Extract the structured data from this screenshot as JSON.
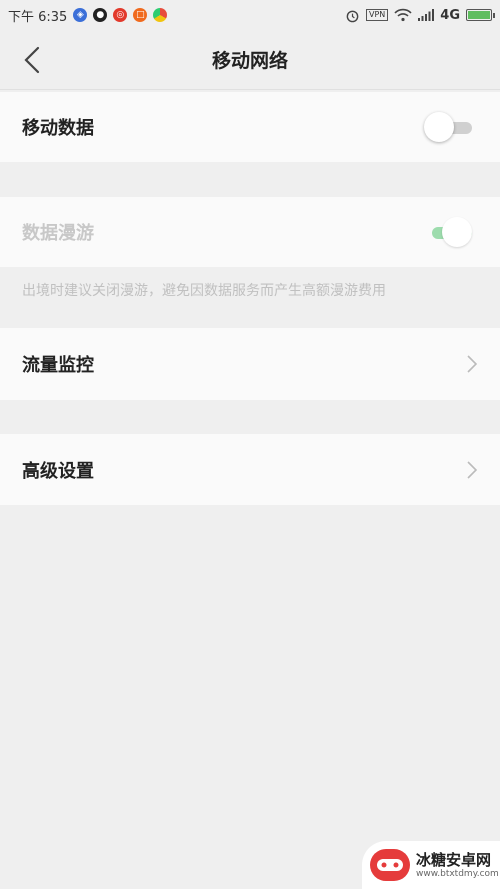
{
  "statusbar": {
    "time": "下午 6:35",
    "network": "4G",
    "vpn": "VPN",
    "battery_level": 1.0
  },
  "header": {
    "title": "移动网络"
  },
  "settings": {
    "mobile_data": {
      "label": "移动数据",
      "enabled": false
    },
    "data_roaming": {
      "label": "数据漫游",
      "enabled": true,
      "disabled": true
    },
    "roaming_hint": "出境时建议关闭漫游，避免因数据服务而产生高额漫游费用",
    "traffic_monitor": {
      "label": "流量监控"
    },
    "advanced": {
      "label": "高级设置"
    }
  },
  "watermark": {
    "name": "冰糖安卓网",
    "url": "www.btxtdmy.com"
  },
  "colors": {
    "accent_on": "#86d49a",
    "track_off": "#d0d0d0",
    "background": "#efefef",
    "row": "#fafafa"
  },
  "icons": [
    "shield-icon",
    "qq-icon",
    "weibo-icon",
    "app-icon",
    "chrome-icon",
    "alarm-icon",
    "wifi-icon",
    "signal-icon",
    "battery-icon",
    "back-icon",
    "chevron-right-icon"
  ]
}
